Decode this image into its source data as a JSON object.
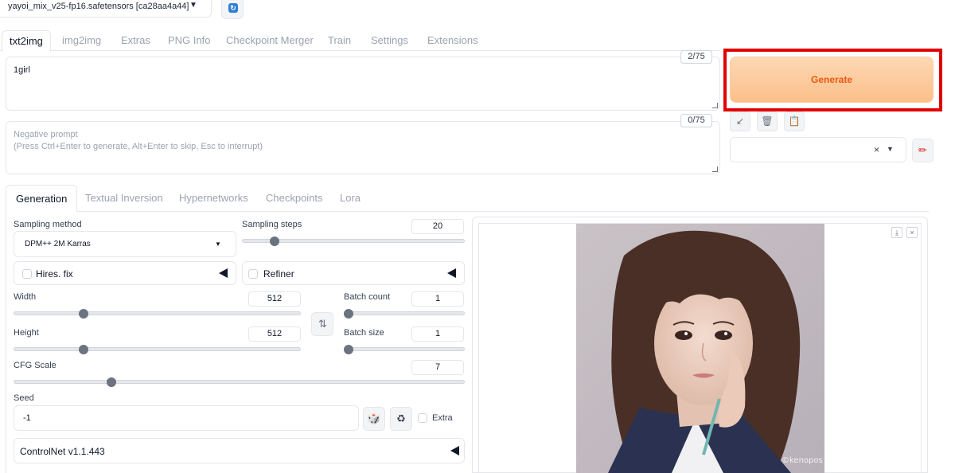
{
  "checkpoint": {
    "selected": "yayoi_mix_v25-fp16.safetensors [ca28aa4a44]"
  },
  "main_tabs": [
    "txt2img",
    "img2img",
    "Extras",
    "PNG Info",
    "Checkpoint Merger",
    "Train",
    "Settings",
    "Extensions"
  ],
  "prompt": {
    "value": "1girl",
    "token_count": "2/75"
  },
  "negative_prompt": {
    "placeholder_line1": "Negative prompt",
    "placeholder_line2": "(Press Ctrl+Enter to generate, Alt+Enter to skip, Esc to interrupt)",
    "token_count": "0/75"
  },
  "generate": {
    "label": "Generate"
  },
  "styles": {
    "clear_symbol": "×"
  },
  "sub_tabs": [
    "Generation",
    "Textual Inversion",
    "Hypernetworks",
    "Checkpoints",
    "Lora"
  ],
  "sampling_method": {
    "label": "Sampling method",
    "value": "DPM++ 2M Karras"
  },
  "sampling_steps": {
    "label": "Sampling steps",
    "value": "20",
    "fraction": 0.13
  },
  "hires_fix": {
    "label": "Hires. fix",
    "checked": false
  },
  "refiner": {
    "label": "Refiner",
    "checked": false
  },
  "width": {
    "label": "Width",
    "value": "512",
    "fraction": 0.235
  },
  "height": {
    "label": "Height",
    "value": "512",
    "fraction": 0.235
  },
  "batch_count": {
    "label": "Batch count",
    "value": "1",
    "fraction": 0.0
  },
  "batch_size": {
    "label": "Batch size",
    "value": "1",
    "fraction": 0.0
  },
  "cfg_scale": {
    "label": "CFG Scale",
    "value": "7",
    "fraction": 0.21
  },
  "seed": {
    "label": "Seed",
    "value": "-1",
    "extra_label": "Extra"
  },
  "controlnet": {
    "label": "ControlNet v1.1.443"
  },
  "output": {
    "watermark": "©kenopos"
  },
  "colors": {
    "accent": "#ea580c",
    "highlight_frame": "#e10000",
    "refresh_icon": "#2f7fd6"
  }
}
